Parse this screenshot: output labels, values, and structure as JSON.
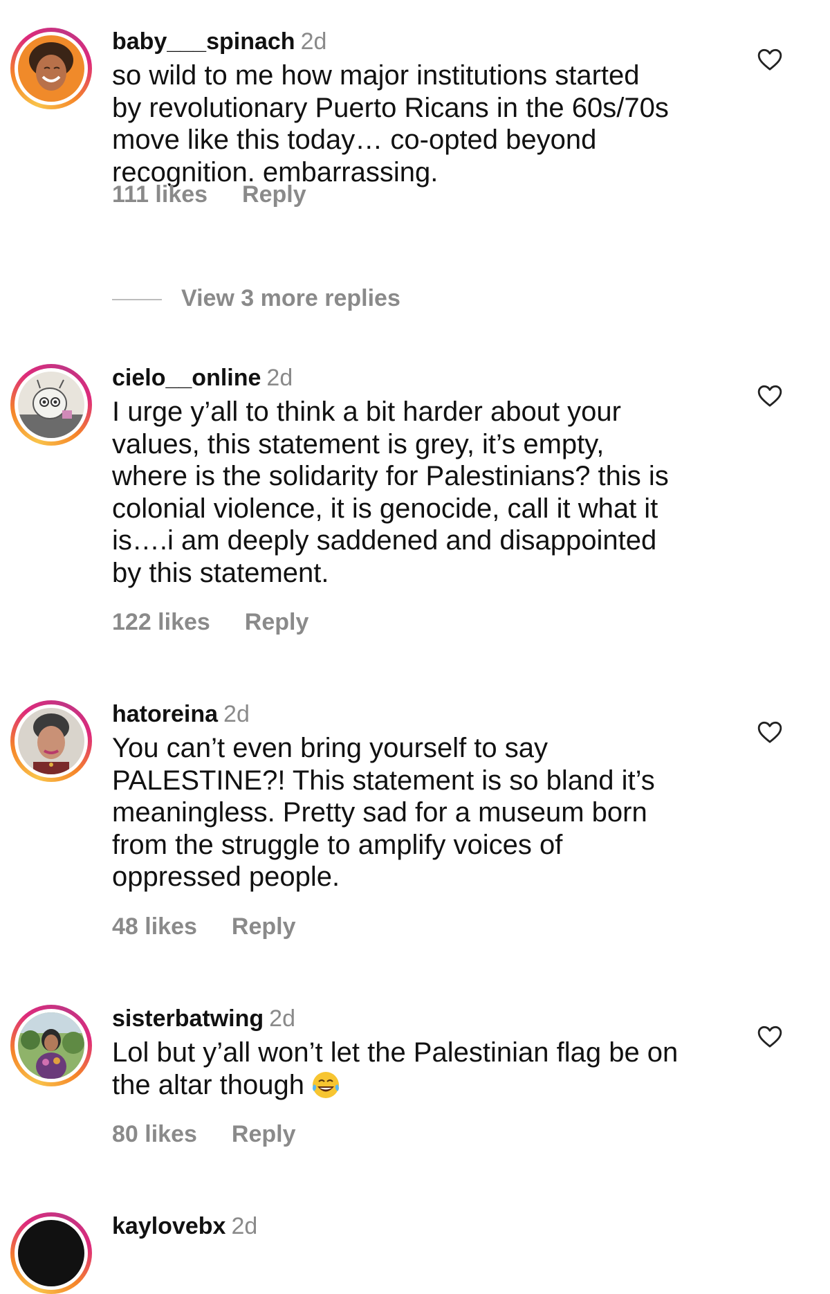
{
  "colors": {
    "text": "#111111",
    "muted": "#8a8a8a",
    "ring_start": "#f9c34a",
    "ring_end": "#c13584"
  },
  "comments": [
    {
      "username": "baby___spinach",
      "time": "2d",
      "text": "so wild to me how major institutions started\nby revolutionary Puerto Ricans in the 60s/70s\nmove like this today… co-opted beyond\nrecognition. embarrassing.",
      "likes": "111 likes",
      "reply": "Reply",
      "avatar_icon": "avatar-smiling-person"
    },
    {
      "username": "cielo__online",
      "time": "2d",
      "text": "I urge y’all to think a bit harder about your\nvalues, this statement is grey, it’s empty,\nwhere is the solidarity for Palestinians? this is\ncolonial violence, it is genocide, call it what it\nis….i am deeply saddened and disappointed\nby this statement.",
      "likes": "122 likes",
      "reply": "Reply",
      "avatar_icon": "avatar-cartoon-character"
    },
    {
      "username": "hatoreina",
      "time": "2d",
      "text": "You can’t even bring yourself to say\nPALESTINE?! This statement is so bland it’s\nmeaningless. Pretty sad for a museum born\nfrom the struggle to amplify voices of\noppressed people.",
      "likes": "48 likes",
      "reply": "Reply",
      "avatar_icon": "avatar-person-portrait"
    },
    {
      "username": "sisterbatwing",
      "time": "2d",
      "text": "Lol but y’all won’t let the Palestinian flag be on\nthe altar though",
      "emoji": "laughing-crying-emoji",
      "likes": "80 likes",
      "reply": "Reply",
      "avatar_icon": "avatar-person-garden"
    },
    {
      "username": "kaylovebx",
      "time": "2d",
      "avatar_icon": "avatar-partial"
    }
  ],
  "view_more_replies": "View 3 more replies"
}
